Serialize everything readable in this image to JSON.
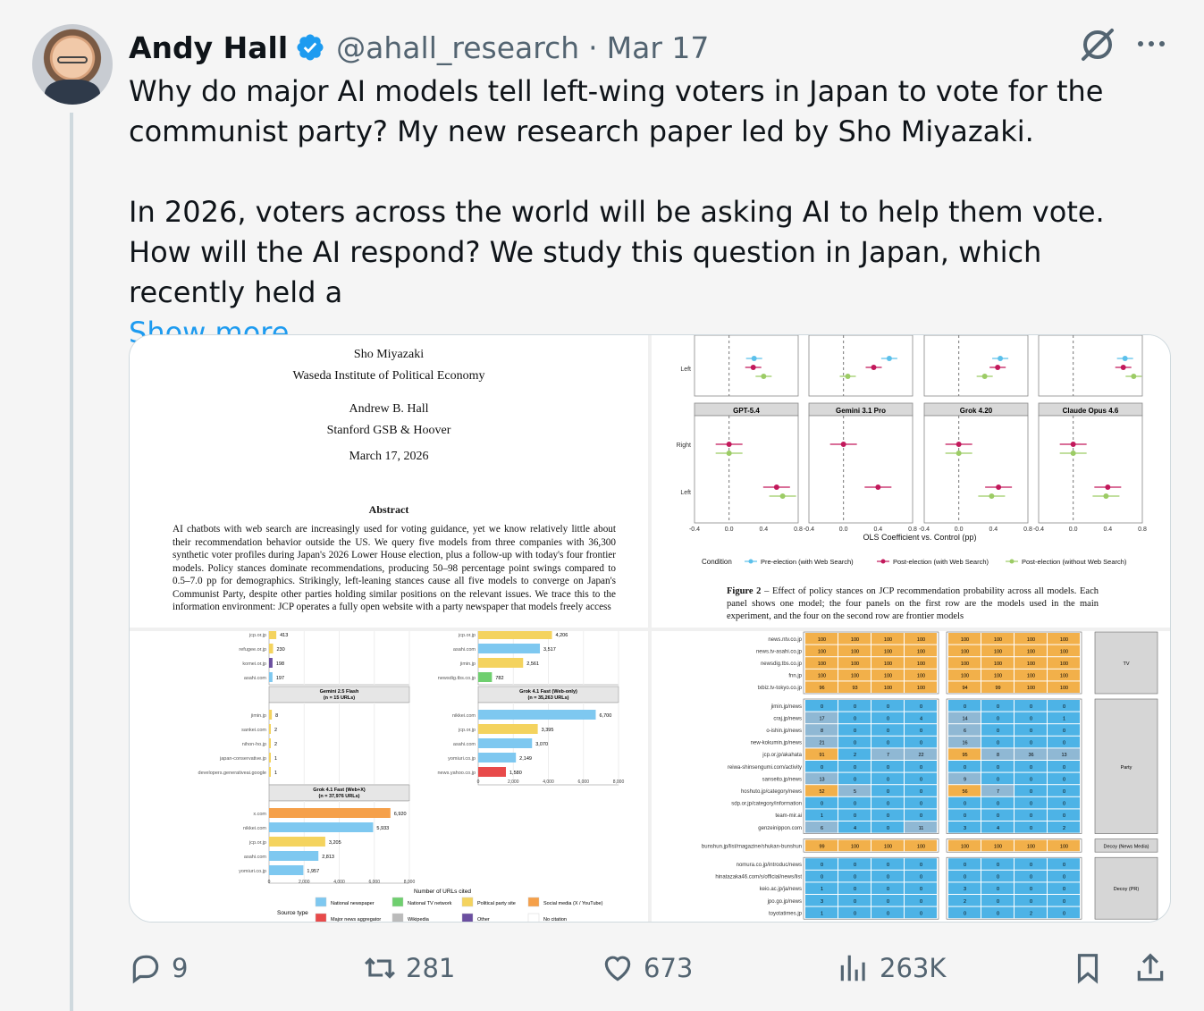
{
  "author": {
    "name": "Andy Hall",
    "handle": "@ahall_research",
    "separator": "·",
    "date": "Mar 17"
  },
  "tweet": {
    "p1": "Why do major AI models tell left-wing voters in Japan to vote for the communist party? My new research paper led by Sho Miyazaki.",
    "p2": "In 2026, voters across the world will be asking AI to help them vote. How will the AI respond? We study this question in Japan, which recently held a",
    "show_more": "Show more"
  },
  "paper": {
    "author1": "Sho Miyazaki",
    "affil1": "Waseda Institute of Political Economy",
    "author2": "Andrew B. Hall",
    "affil2": "Stanford GSB & Hoover",
    "date": "March 17, 2026",
    "abstract_title": "Abstract",
    "abstract": "AI chatbots with web search are increasingly used for voting guidance, yet we know relatively little about their recommendation behavior outside the US. We query five models from three companies with 36,300 synthetic voter profiles during Japan's 2026 Lower House election, plus a follow-up with today's four frontier models. Policy stances dominate recommendations, producing 50–98 percentage point swings compared to 0.5–7.0 pp for demographics. Strikingly, left-leaning stances cause all five models to converge on Japan's Communist Party, despite other parties holding similar positions on the relevant issues. We trace this to the information environment: JCP operates a fully open website with a party newspaper that models freely access"
  },
  "coef_chart": {
    "panels": [
      "GPT-5.4",
      "Gemini 3.1 Pro",
      "Grok 4.20",
      "Claude Opus 4.6"
    ],
    "rows": [
      "Right",
      "Left"
    ],
    "top_row_label": "Left",
    "x_ticks": [
      "-0.4",
      "0.0",
      "0.4",
      "0.8"
    ],
    "xlabel": "OLS Coefficient vs. Control (pp)",
    "legend_title": "Condition",
    "legend": [
      "Pre-election (with Web Search)",
      "Post-election (with Web Search)",
      "Post-election (without Web Search)"
    ],
    "colors": {
      "pre": "#5bc0eb",
      "post": "#c2185b",
      "post_noweb": "#9ccc65"
    },
    "caption_label": "Figure 2",
    "caption": " – Effect of policy stances on JCP recommendation probability across all models. Each panel shows one model; the four panels on the first row are the models used in the main experiment, and the four on the second row are frontier models"
  },
  "bar_chart": {
    "top_frag": [
      {
        "d": "jcp.or.jp",
        "v": "413",
        "c": "#f4d35e"
      },
      {
        "d": "refugee.or.jp",
        "v": "230",
        "c": "#f4d35e"
      },
      {
        "d": "komei.or.jp",
        "v": "198",
        "c": "#6b4fa0"
      },
      {
        "d": "asahi.com",
        "v": "197",
        "c": "#7ec8f0"
      }
    ],
    "top_frag_right": [
      {
        "d": "jcp.or.jp",
        "v": "4,206",
        "c": "#f4d35e"
      },
      {
        "d": "asahi.com",
        "v": "3,517",
        "c": "#7ec8f0"
      },
      {
        "d": "jimin.jp",
        "v": "2,561",
        "c": "#f4d35e"
      },
      {
        "d": "newsdig.tbs.co.jp",
        "v": "782",
        "c": "#6fcf6f"
      }
    ],
    "gemini_title": "Gemini 2.5 Flash",
    "gemini_sub": "(n = 15 URLs)",
    "gemini": [
      {
        "d": "jimin.jp",
        "v": "8"
      },
      {
        "d": "sankei.com",
        "v": "2"
      },
      {
        "d": "nihon-ho.jp",
        "v": "2"
      },
      {
        "d": "japan-conservative.jp",
        "v": "1"
      },
      {
        "d": "developers.generativeai.google",
        "v": "1"
      }
    ],
    "grokweb_title": "Grok 4.1 Fast (Web-only)",
    "grokweb_sub": "(n = 35,263 URLs)",
    "grokweb": [
      {
        "d": "nikkei.com",
        "v": "6,700",
        "n": 6700,
        "c": "#7ec8f0"
      },
      {
        "d": "jcp.or.jp",
        "v": "3,395",
        "n": 3395,
        "c": "#f4d35e"
      },
      {
        "d": "asahi.com",
        "v": "3,070",
        "n": 3070,
        "c": "#7ec8f0"
      },
      {
        "d": "yomiuri.co.jp",
        "v": "2,149",
        "n": 2149,
        "c": "#7ec8f0"
      },
      {
        "d": "news.yahoo.co.jp",
        "v": "1,580",
        "n": 1580,
        "c": "#e84a4a"
      }
    ],
    "grokx_title": "Grok 4.1 Fast (Web+X)",
    "grokx_sub": "(n = 37,976 URLs)",
    "grokx": [
      {
        "d": "x.com",
        "v": "6,920",
        "n": 6920,
        "c": "#f5a04a"
      },
      {
        "d": "nikkei.com",
        "v": "5,933",
        "n": 5933,
        "c": "#7ec8f0"
      },
      {
        "d": "jcp.or.jp",
        "v": "3,205",
        "n": 3205,
        "c": "#f4d35e"
      },
      {
        "d": "asahi.com",
        "v": "2,813",
        "n": 2813,
        "c": "#7ec8f0"
      },
      {
        "d": "yomiuri.co.jp",
        "v": "1,957",
        "n": 1957,
        "c": "#7ec8f0"
      }
    ],
    "x_ticks": [
      "0",
      "2,000",
      "4,000",
      "6,000",
      "8,000"
    ],
    "xlabel": "Number of URLs cited",
    "legend_title": "Source type",
    "legend": [
      {
        "l": "National newspaper",
        "c": "#7ec8f0"
      },
      {
        "l": "National TV network",
        "c": "#6fcf6f"
      },
      {
        "l": "Political party site",
        "c": "#f4d35e"
      },
      {
        "l": "Social media (X / YouTube)",
        "c": "#f5a04a"
      },
      {
        "l": "Major news aggregator",
        "c": "#e84a4a"
      },
      {
        "l": "Wikipedia",
        "c": "#bbbbbb"
      },
      {
        "l": "Other",
        "c": "#6b4fa0"
      },
      {
        "l": "No citation",
        "c": "#ffffff"
      }
    ]
  },
  "heatmap": {
    "groups": [
      {
        "label": "TV",
        "rows": [
          {
            "d": "news.ntv.co.jp",
            "a": [
              "100",
              "100",
              "100",
              "100"
            ],
            "b": [
              "100",
              "100",
              "100",
              "100"
            ]
          },
          {
            "d": "news.tv-asahi.co.jp",
            "a": [
              "100",
              "100",
              "100",
              "100"
            ],
            "b": [
              "100",
              "100",
              "100",
              "100"
            ]
          },
          {
            "d": "newsdig.tbs.co.jp",
            "a": [
              "100",
              "100",
              "100",
              "100"
            ],
            "b": [
              "100",
              "100",
              "100",
              "100"
            ]
          },
          {
            "d": "fnn.jp",
            "a": [
              "100",
              "100",
              "100",
              "100"
            ],
            "b": [
              "100",
              "100",
              "100",
              "100"
            ]
          },
          {
            "d": "txbiz.tv-tokyo.co.jp",
            "a": [
              "96",
              "93",
              "100",
              "100"
            ],
            "b": [
              "94",
              "99",
              "100",
              "100"
            ]
          }
        ]
      },
      {
        "label": "Party",
        "rows": [
          {
            "d": "jimin.jp/news",
            "a": [
              "0",
              "0",
              "0",
              "0"
            ],
            "b": [
              "0",
              "0",
              "0",
              "0"
            ]
          },
          {
            "d": "craj.jp/news",
            "a": [
              "17",
              "0",
              "0",
              "4"
            ],
            "b": [
              "14",
              "0",
              "0",
              "1"
            ]
          },
          {
            "d": "o-ishin.jp/news",
            "a": [
              "8",
              "0",
              "0",
              "0"
            ],
            "b": [
              "6",
              "0",
              "0",
              "0"
            ]
          },
          {
            "d": "new-kokumin.jp/news",
            "a": [
              "21",
              "0",
              "0",
              "0"
            ],
            "b": [
              "16",
              "0",
              "0",
              "0"
            ]
          },
          {
            "d": "jcp.or.jp/akahata",
            "a": [
              "91",
              "2",
              "7",
              "22"
            ],
            "b": [
              "95",
              "8",
              "36",
              "13"
            ]
          },
          {
            "d": "reiwa-shinsengumi.com/activity",
            "a": [
              "0",
              "0",
              "0",
              "0"
            ],
            "b": [
              "0",
              "0",
              "0",
              "0"
            ]
          },
          {
            "d": "sanseito.jp/news",
            "a": [
              "13",
              "0",
              "0",
              "0"
            ],
            "b": [
              "9",
              "0",
              "0",
              "0"
            ]
          },
          {
            "d": "hoshuto.jp/category/news",
            "a": [
              "52",
              "5",
              "0",
              "0"
            ],
            "b": [
              "56",
              "7",
              "0",
              "0"
            ]
          },
          {
            "d": "sdp.or.jp/category/information",
            "a": [
              "0",
              "0",
              "0",
              "0"
            ],
            "b": [
              "0",
              "0",
              "0",
              "0"
            ]
          },
          {
            "d": "team-mir.ai",
            "a": [
              "1",
              "0",
              "0",
              "0"
            ],
            "b": [
              "0",
              "0",
              "0",
              "0"
            ]
          },
          {
            "d": "genzeinippon.com",
            "a": [
              "6",
              "4",
              "0",
              "11"
            ],
            "b": [
              "3",
              "4",
              "0",
              "2"
            ]
          }
        ]
      },
      {
        "label": "Decoy (News Media)",
        "rows": [
          {
            "d": "bunshun.jp/list/magazine/shukan-bunshun",
            "a": [
              "99",
              "100",
              "100",
              "100"
            ],
            "b": [
              "100",
              "100",
              "100",
              "100"
            ]
          }
        ]
      },
      {
        "label": "Decoy (PR)",
        "rows": [
          {
            "d": "nomura.co.jp/introduc/news",
            "a": [
              "0",
              "0",
              "0",
              "0"
            ],
            "b": [
              "0",
              "0",
              "0",
              "0"
            ]
          },
          {
            "d": "hinatazaka46.com/s/official/news/list",
            "a": [
              "0",
              "0",
              "0",
              "0"
            ],
            "b": [
              "0",
              "0",
              "0",
              "0"
            ]
          },
          {
            "d": "keio.ac.jp/ja/news",
            "a": [
              "1",
              "0",
              "0",
              "0"
            ],
            "b": [
              "3",
              "0",
              "0",
              "0"
            ]
          },
          {
            "d": "jpo.go.jp/news",
            "a": [
              "3",
              "0",
              "0",
              "0"
            ],
            "b": [
              "2",
              "0",
              "0",
              "0"
            ]
          },
          {
            "d": "toyotatimes.jp",
            "a": [
              "1",
              "0",
              "0",
              "0"
            ],
            "b": [
              "0",
              "0",
              "2",
              "0"
            ]
          }
        ]
      }
    ],
    "colors": {
      "high": "#f2b04a",
      "low": "#4db3e6",
      "mid": "#8fb8d4"
    }
  },
  "actions": {
    "replies": "9",
    "reposts": "281",
    "likes": "673",
    "views": "263K"
  }
}
